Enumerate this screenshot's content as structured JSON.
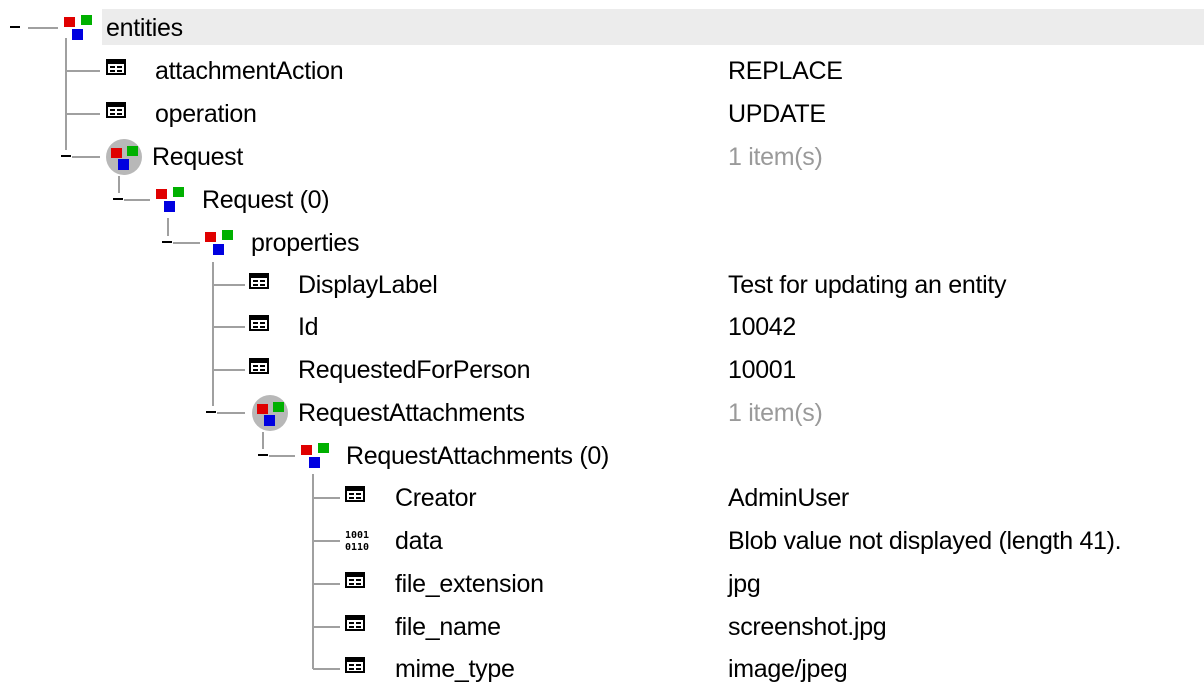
{
  "tree": {
    "rows": [
      {
        "label": "entities",
        "value": "",
        "icon": "entity-icon",
        "expanded": true,
        "selected": true
      },
      {
        "label": "attachmentAction",
        "value": "REPLACE",
        "icon": "field-icon"
      },
      {
        "label": "operation",
        "value": "UPDATE",
        "icon": "field-icon"
      },
      {
        "label": "Request",
        "value": "1 item(s)",
        "icon": "collection-icon",
        "expanded": true
      },
      {
        "label": "Request (0)",
        "value": "",
        "icon": "entity-icon",
        "expanded": true
      },
      {
        "label": "properties",
        "value": "",
        "icon": "entity-icon",
        "expanded": true
      },
      {
        "label": "DisplayLabel",
        "value": "Test for updating an entity",
        "icon": "field-icon"
      },
      {
        "label": "Id",
        "value": "10042",
        "icon": "field-icon"
      },
      {
        "label": "RequestedForPerson",
        "value": "10001",
        "icon": "field-icon"
      },
      {
        "label": "RequestAttachments",
        "value": "1 item(s)",
        "icon": "collection-icon",
        "expanded": true
      },
      {
        "label": "RequestAttachments (0)",
        "value": "",
        "icon": "entity-icon",
        "expanded": true
      },
      {
        "label": "Creator",
        "value": "AdminUser",
        "icon": "field-icon"
      },
      {
        "label": "data",
        "value": "Blob value not displayed (length 41).",
        "icon": "binary-icon"
      },
      {
        "label": "file_extension",
        "value": "jpg",
        "icon": "field-icon"
      },
      {
        "label": "file_name",
        "value": "screenshot.jpg",
        "icon": "field-icon"
      },
      {
        "label": "mime_type",
        "value": "image/jpeg",
        "icon": "field-icon"
      }
    ]
  },
  "colors": {
    "selection": "#ececec",
    "muted_value": "#9a9a9a",
    "tree_line": "#a0a0a0",
    "icon_red": "#e00000",
    "icon_green": "#00b000",
    "icon_blue": "#0000e0"
  }
}
